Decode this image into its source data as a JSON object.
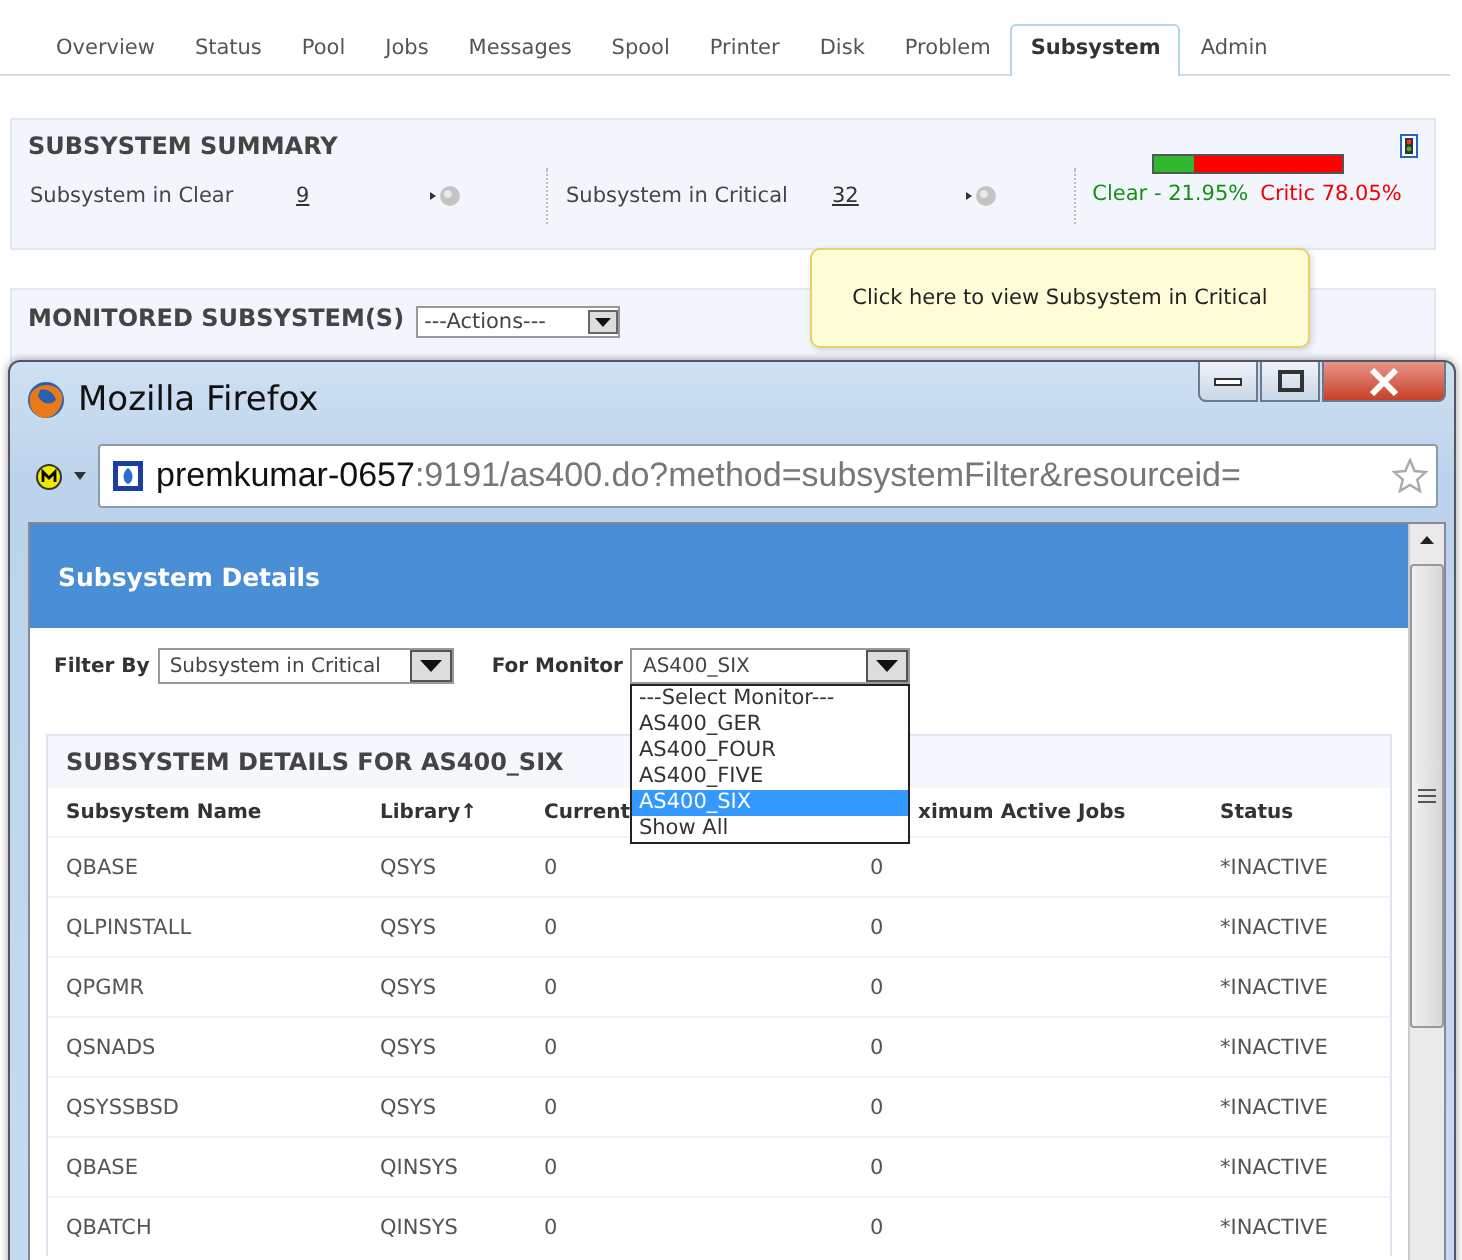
{
  "tabs": [
    {
      "label": "Overview",
      "selected": false
    },
    {
      "label": "Status",
      "selected": false
    },
    {
      "label": "Pool",
      "selected": false
    },
    {
      "label": "Jobs",
      "selected": false
    },
    {
      "label": "Messages",
      "selected": false
    },
    {
      "label": "Spool",
      "selected": false
    },
    {
      "label": "Printer",
      "selected": false
    },
    {
      "label": "Disk",
      "selected": false
    },
    {
      "label": "Problem",
      "selected": false
    },
    {
      "label": "Subsystem",
      "selected": true
    },
    {
      "label": "Admin",
      "selected": false
    }
  ],
  "summary": {
    "title": "SUBSYSTEM SUMMARY",
    "items": [
      {
        "label": "Subsystem in Clear",
        "count": "9"
      },
      {
        "label": "Subsystem in Critical",
        "count": "32"
      }
    ],
    "bar": {
      "level": 0.2195
    },
    "clear_text": "Clear - 21.95%",
    "critical_text": "Critic 78.05%"
  },
  "monitored": {
    "title": "MONITORED SUBSYSTEM(S)",
    "actions": "---Actions---"
  },
  "tooltip": {
    "text": "Click here to view Subsystem in Critical"
  },
  "browser": {
    "title": "Mozilla Firefox",
    "url_host": "premkumar-0657",
    "url_path": ":9191/as400.do?method=subsystemFilter&resourceid=",
    "page_title": "Subsystem Details",
    "filters": [
      {
        "label": "Filter By",
        "value": "Subsystem in Critical"
      },
      {
        "label": "For Monitor",
        "value": "AS400_SIX",
        "expanded": true,
        "options": [
          {
            "label": "---Select Monitor---",
            "selected": false
          },
          {
            "label": "AS400_GER",
            "selected": false
          },
          {
            "label": "AS400_FOUR",
            "selected": false
          },
          {
            "label": "AS400_FIVE",
            "selected": false
          },
          {
            "label": "AS400_SIX",
            "selected": true
          },
          {
            "label": "Show All",
            "selected": false
          }
        ]
      }
    ],
    "table": {
      "title": "SUBSYSTEM DETAILS FOR AS400_SIX",
      "columns": [
        {
          "label": "Subsystem Name"
        },
        {
          "label": "Library",
          "sort": "↑"
        },
        {
          "label": "Current"
        },
        {
          "label": "ximum Active Jobs"
        },
        {
          "label": "Status"
        }
      ],
      "rows": [
        [
          "QBASE",
          "QSYS",
          "0",
          "0",
          "*INACTIVE"
        ],
        [
          "QLPINSTALL",
          "QSYS",
          "0",
          "0",
          "*INACTIVE"
        ],
        [
          "QPGMR",
          "QSYS",
          "0",
          "0",
          "*INACTIVE"
        ],
        [
          "QSNADS",
          "QSYS",
          "0",
          "0",
          "*INACTIVE"
        ],
        [
          "QSYSSBSD",
          "QSYS",
          "0",
          "0",
          "*INACTIVE"
        ],
        [
          "QBASE",
          "QINSYS",
          "0",
          "0",
          "*INACTIVE"
        ],
        [
          "QBATCH",
          "QINSYS",
          "0",
          "0",
          "*INACTIVE"
        ]
      ]
    }
  }
}
